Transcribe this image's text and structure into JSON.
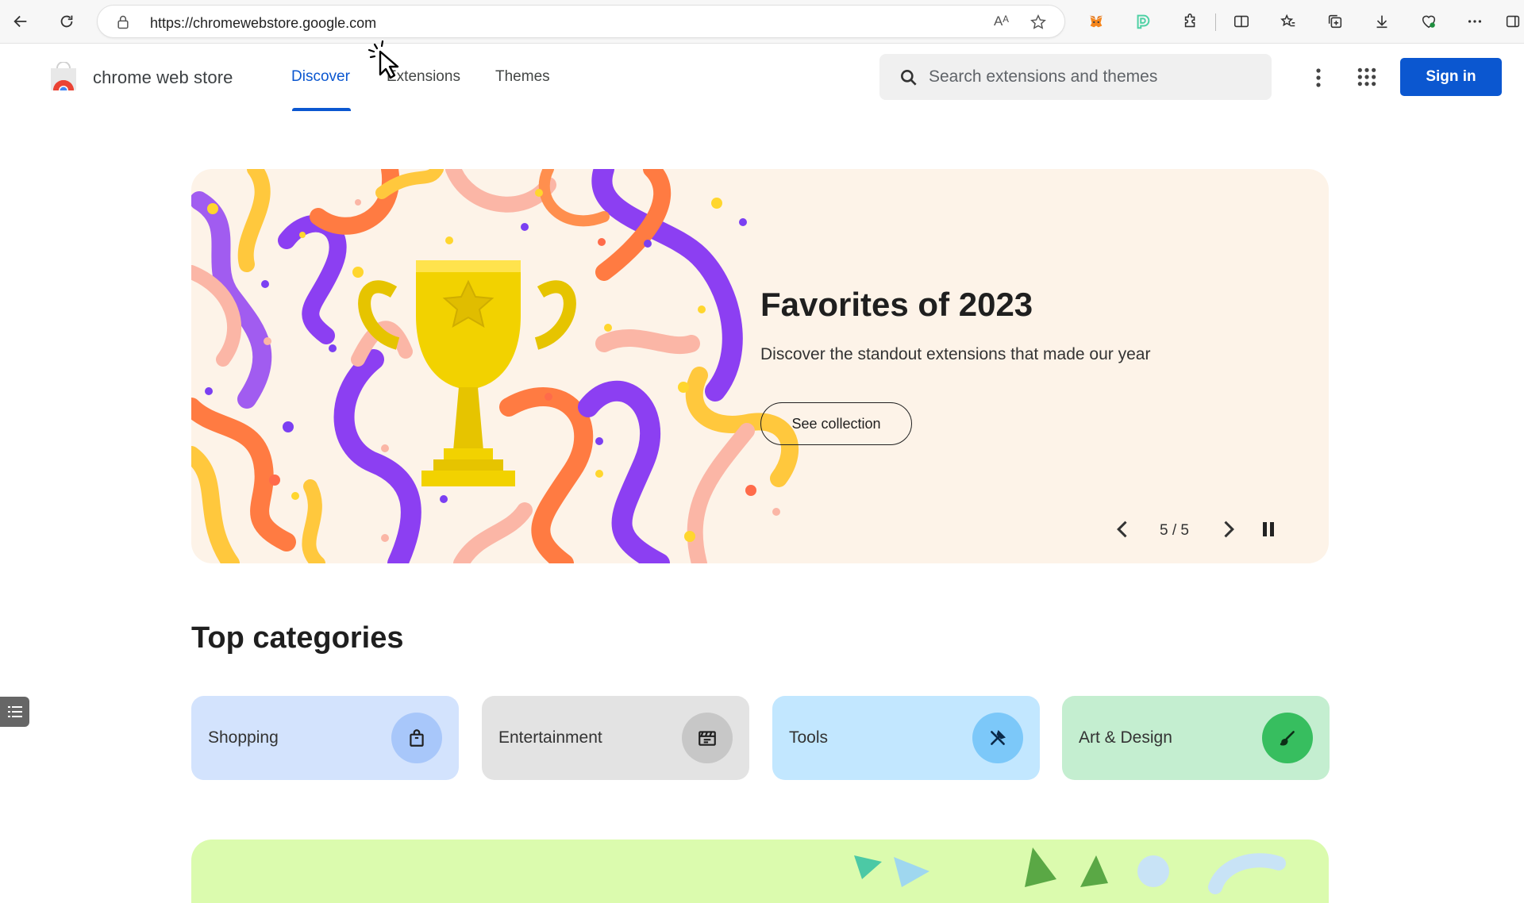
{
  "browser": {
    "url": "https://chromewebstore.google.com",
    "read_aloud": "Aᴬ"
  },
  "header": {
    "store_name": "chrome web store",
    "tabs": [
      {
        "label": "Discover",
        "active": true
      },
      {
        "label": "Extensions",
        "active": false
      },
      {
        "label": "Themes",
        "active": false
      }
    ],
    "search_placeholder": "Search extensions and themes",
    "signin_label": "Sign in"
  },
  "hero": {
    "title": "Favorites of 2023",
    "subtitle": "Discover the standout extensions that made our year",
    "cta_label": "See collection",
    "counter": "5 / 5"
  },
  "categories": {
    "title": "Top categories",
    "items": [
      {
        "label": "Shopping",
        "icon": "shopping-bag-icon",
        "bg": "#d3e3fd",
        "circle": "#a8c7fa"
      },
      {
        "label": "Entertainment",
        "icon": "clapperboard-icon",
        "bg": "#e3e3e3",
        "circle": "#c7c7c7"
      },
      {
        "label": "Tools",
        "icon": "tools-icon",
        "bg": "#c2e7ff",
        "circle": "#7cc8f9"
      },
      {
        "label": "Art & Design",
        "icon": "paintbrush-icon",
        "bg": "#c4eed0",
        "circle": "#37be5f"
      }
    ]
  },
  "colors": {
    "accent": "#0b57d0",
    "hero_bg": "#fdf3e8",
    "promo_bg": "#dbfbae"
  }
}
